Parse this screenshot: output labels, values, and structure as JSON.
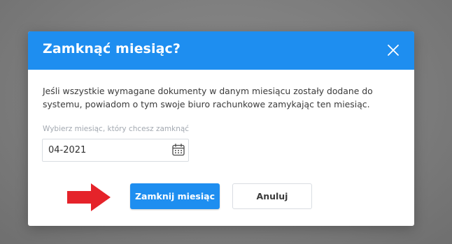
{
  "dialog": {
    "title": "Zamknąć miesiąc?",
    "description": "Jeśli wszystkie wymagane dokumenty w danym miesiącu zostały dodane do systemu, powiadom o tym swoje biuro rachunkowe zamykając ten miesiąc.",
    "month_field": {
      "label": "Wybierz miesiąc, który chcesz zamknąć",
      "value": "04-2021"
    },
    "buttons": {
      "confirm_label": "Zamknij miesiąc",
      "cancel_label": "Anuluj"
    }
  },
  "icons": {
    "close": "close-icon",
    "calendar": "calendar-icon",
    "annotation_arrow": "arrow-right-icon"
  },
  "colors": {
    "accent": "#1e8ef0",
    "annotation_arrow": "#e5232a",
    "backdrop": "#7d7d7d"
  }
}
